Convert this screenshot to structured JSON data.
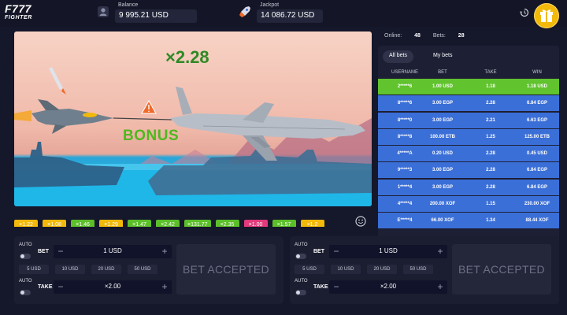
{
  "logo": {
    "line1": "F777",
    "line2": "FIGHTER"
  },
  "balance": {
    "label": "Balance",
    "value": "9 995.21 USD"
  },
  "jackpot": {
    "label": "Jackpot",
    "value": "14 086.72 USD"
  },
  "game": {
    "multiplier": "×2.28",
    "bonus_text": "BONUS"
  },
  "stats": {
    "online_label": "Online:",
    "online_value": "48",
    "bets_label": "Bets:",
    "bets_value": "28"
  },
  "tabs": [
    {
      "label": "All bets"
    },
    {
      "label": "My bets"
    }
  ],
  "table": {
    "headers": [
      "USERNAME",
      "BET",
      "TAKE",
      "WIN"
    ],
    "rows": [
      {
        "username": "2*****6",
        "bet": "1.00 USD",
        "take": "1.18",
        "win": "1.18 USD",
        "status": "won"
      },
      {
        "username": "8*****6",
        "bet": "3.00 EGP",
        "take": "2.28",
        "win": "6.84 EGP",
        "status": "active"
      },
      {
        "username": "8*****0",
        "bet": "3.00 EGP",
        "take": "2.21",
        "win": "6.63 EGP",
        "status": "active"
      },
      {
        "username": "8*****8",
        "bet": "100.00 ETB",
        "take": "1.25",
        "win": "125.00 ETB",
        "status": "active"
      },
      {
        "username": "4*****A",
        "bet": "0.20 USD",
        "take": "2.28",
        "win": "0.45 USD",
        "status": "active"
      },
      {
        "username": "9*****3",
        "bet": "3.00 EGP",
        "take": "2.28",
        "win": "6.84 EGP",
        "status": "active"
      },
      {
        "username": "1*****4",
        "bet": "3.00 EGP",
        "take": "2.28",
        "win": "6.84 EGP",
        "status": "active"
      },
      {
        "username": "4*****4",
        "bet": "200.00 XOF",
        "take": "1.15",
        "win": "230.00 XOF",
        "status": "active"
      },
      {
        "username": "E*****4",
        "bet": "66.00 XOF",
        "take": "1.34",
        "win": "88.44 XOF",
        "status": "active"
      }
    ]
  },
  "history": [
    {
      "value": "×1.22",
      "color": "#f2b90b"
    },
    {
      "value": "×1.08",
      "color": "#f2b90b"
    },
    {
      "value": "×1.46",
      "color": "#5cbf2a"
    },
    {
      "value": "×1.29",
      "color": "#f2b90b"
    },
    {
      "value": "×1.47",
      "color": "#5cbf2a"
    },
    {
      "value": "×2.42",
      "color": "#5cbf2a"
    },
    {
      "value": "×131.77",
      "color": "#5cbf2a"
    },
    {
      "value": "×2.35",
      "color": "#5cbf2a"
    },
    {
      "value": "×1.00",
      "color": "#e23a7a"
    },
    {
      "value": "×1.57",
      "color": "#5cbf2a"
    },
    {
      "value": "×1.2",
      "color": "#f2b90b"
    }
  ],
  "panels": [
    {
      "auto_label": "AUTO",
      "bet_label": "BET",
      "bet_value": "1 USD",
      "quick": [
        "5 USD",
        "10 USD",
        "20 USD",
        "50 USD"
      ],
      "take_label": "TAKE",
      "take_value": "×2.00",
      "status": "BET ACCEPTED"
    },
    {
      "auto_label": "AUTO",
      "bet_label": "BET",
      "bet_value": "1 USD",
      "quick": [
        "5 USD",
        "10 USD",
        "20 USD",
        "50 USD"
      ],
      "take_label": "TAKE",
      "take_value": "×2.00",
      "status": "BET ACCEPTED"
    }
  ],
  "colors": {
    "win_row": "#61c32e",
    "active_row": "#3b6fd8",
    "accent": "#f2b90b"
  },
  "icons": [
    "wallet-icon",
    "rocket-icon",
    "history-icon",
    "gift-icon",
    "warning-icon",
    "smile-icon"
  ]
}
